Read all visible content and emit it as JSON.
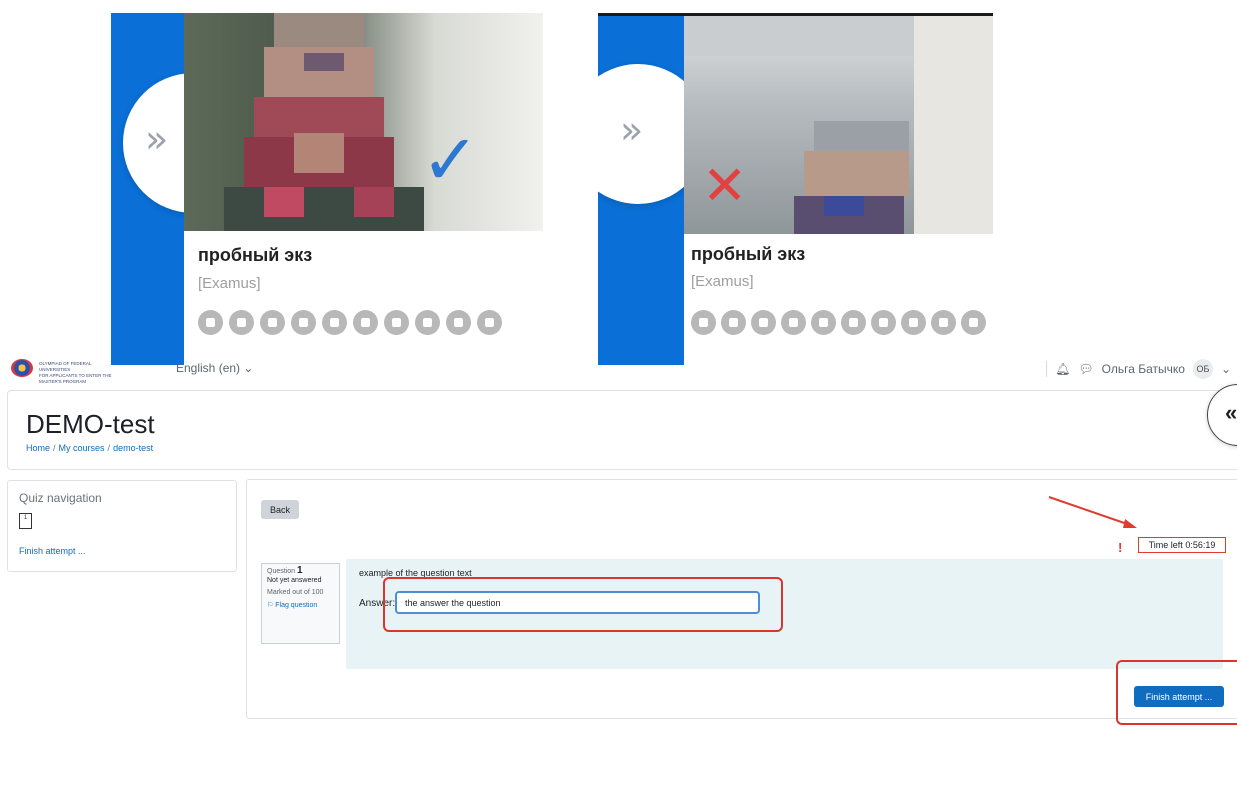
{
  "proctor_cards": [
    {
      "title": "пробный экз",
      "subtitle": "[Examus]",
      "status_icon": "check-icon",
      "status_color": "#2d78d0"
    },
    {
      "title": "пробный экз",
      "subtitle": "[Examus]",
      "status_icon": "cross-icon",
      "status_color": "#e24141"
    }
  ],
  "topbar": {
    "logo_line1": "OLYMPIAD OF FEDERAL UNIVERSITIES",
    "logo_line2": "FOR APPLICANTS TO ENTER THE MASTER'S PROGRAM",
    "language": "English (en) ⌄",
    "user_name": "Ольга Батычко",
    "user_initials": "ОБ"
  },
  "header": {
    "title": "DEMO-test",
    "breadcrumb": [
      "Home",
      "My courses",
      "demo-test"
    ],
    "breadcrumb_sep": "/"
  },
  "quiz_nav": {
    "title": "Quiz navigation",
    "question_number": "1",
    "finish_link": "Finish attempt ..."
  },
  "main": {
    "back_label": "Back",
    "time_left": "Time left 0:56:19",
    "time_mark": "!",
    "question_word": "Question",
    "question_number": "1",
    "status": "Not yet answered",
    "marked_out_of": "Marked out of 100",
    "flag_label": "Flag question",
    "question_text": "example of the question text",
    "answer_label": "Answer:",
    "answer_value": "the answer the question",
    "finish_button": "Finish attempt ..."
  },
  "colors": {
    "moodle_blue": "#0f6cbf",
    "examus_blue": "#0a6fd6",
    "annotation_red": "#d9362b",
    "question_bg": "#e7f3f5"
  }
}
